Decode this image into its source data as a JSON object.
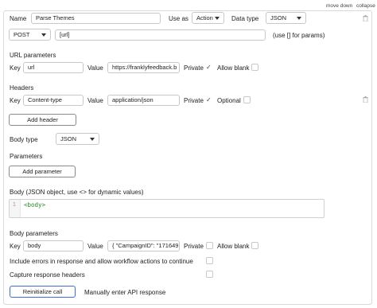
{
  "header_links": {
    "move_down": "move down",
    "collapse": "collapse"
  },
  "row1": {
    "name_label": "Name",
    "name_value": "Parse Themes",
    "use_as_label": "Use as",
    "use_as_value": "Action",
    "data_type_label": "Data type",
    "data_type_value": "JSON"
  },
  "request": {
    "method": "POST",
    "url": "[url]",
    "url_hint": "(use [] for params)"
  },
  "url_parameters": {
    "title": "URL parameters",
    "key_label": "Key",
    "key": "url",
    "value_label": "Value",
    "value": "https://franklyfeedback.b",
    "private_label": "Private",
    "private_checked": true,
    "allow_blank_label": "Allow blank",
    "allow_blank_checked": false
  },
  "headers": {
    "title": "Headers",
    "key_label": "Key",
    "key": "Content-type",
    "value_label": "Value",
    "value": "application/json",
    "private_label": "Private",
    "private_checked": true,
    "optional_label": "Optional",
    "optional_checked": false,
    "add_button": "Add header"
  },
  "body_type": {
    "label": "Body type",
    "value": "JSON"
  },
  "parameters": {
    "title": "Parameters",
    "add_button": "Add parameter"
  },
  "body_json": {
    "title": "Body (JSON object, use <> for dynamic values)",
    "line_number": "1",
    "code": "<body>"
  },
  "body_parameters": {
    "title": "Body parameters",
    "key_label": "Key",
    "key": "body",
    "value_label": "Value",
    "value": "{   \"CampaignID\": \"171649",
    "private_label": "Private",
    "private_checked": false,
    "allow_blank_label": "Allow blank",
    "allow_blank_checked": false
  },
  "options": {
    "include_errors": "Include errors in response and allow workflow actions to continue",
    "capture_headers": "Capture response headers"
  },
  "footer": {
    "reinitialize_button": "Reinitialize call",
    "manual_label": "Manually enter API response"
  },
  "colors": {
    "code_green": "#2a8a2a",
    "accent_blue": "#3b6ed9",
    "border": "#c8c8c8"
  }
}
